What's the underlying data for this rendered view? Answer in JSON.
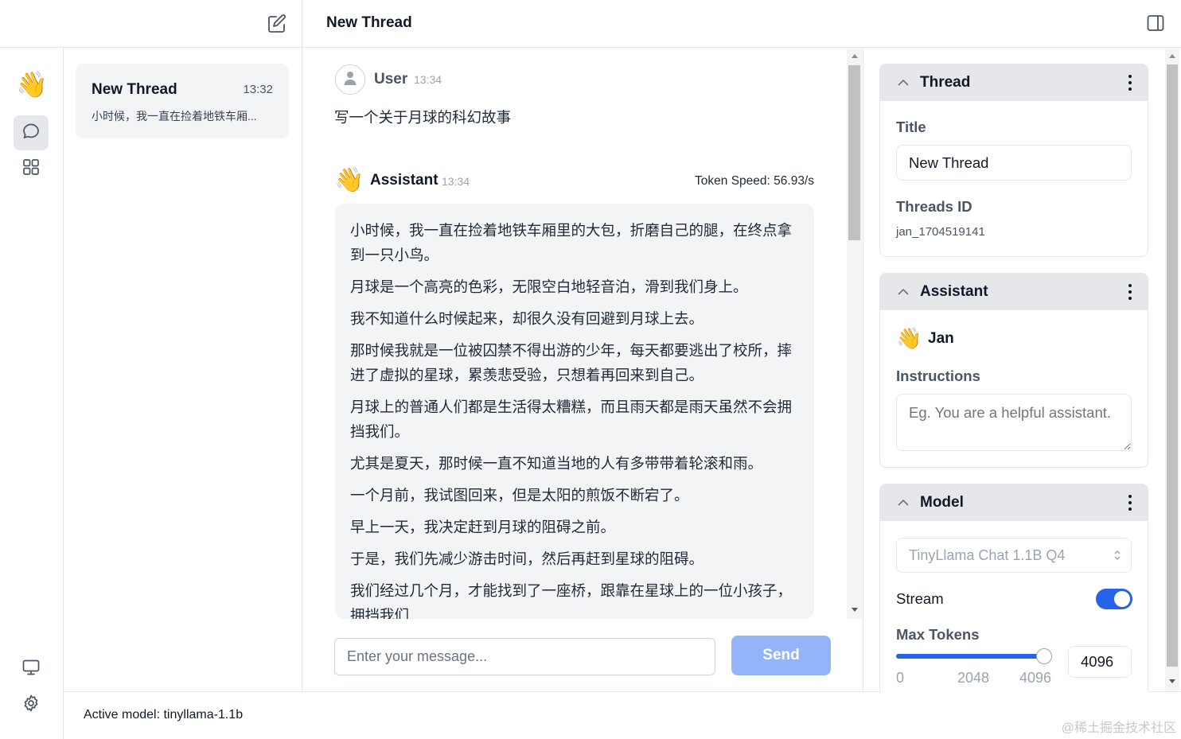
{
  "header": {
    "title": "New Thread"
  },
  "thread_list": {
    "items": [
      {
        "title": "New Thread",
        "time": "13:32",
        "preview": "小时候，我一直在捡着地铁车厢..."
      }
    ]
  },
  "chat": {
    "user_message": {
      "name": "User",
      "time": "13:34",
      "text": "写一个关于月球的科幻故事"
    },
    "assistant_message": {
      "name": "Assistant",
      "time": "13:34",
      "token_speed": "Token Speed: 56.93/s",
      "paragraphs": [
        "小时候，我一直在捡着地铁车厢里的大包，折磨自己的腿，在终点拿到一只小鸟。",
        "月球是一个高亮的色彩，无限空白地轻音泊，滑到我们身上。",
        "我不知道什么时候起来，却很久没有回避到月球上去。",
        "那时候我就是一位被囚禁不得出游的少年，每天都要逃出了校所，摔进了虚拟的星球，累羡悲受验，只想着再回来到自己。",
        "月球上的普通人们都是生活得太糟糕，而且雨天都是雨天虽然不会拥挡我们。",
        "尤其是夏天，那时候一直不知道当地的人有多带带着轮滚和雨。",
        "一个月前，我试图回来，但是太阳的煎饭不断宕了。",
        "早上一天，我决定赶到月球的阻碍之前。",
        "于是，我们先减少游击时间，然后再赶到星球的阻碍。",
        "我们经过几个月，才能找到了一座桥，跟靠在星球上的一位小孩子，拥挡我们"
      ]
    },
    "input": {
      "placeholder": "Enter your message...",
      "value": ""
    },
    "send_label": "Send"
  },
  "right_panel": {
    "thread": {
      "header": "Thread",
      "title_label": "Title",
      "title_value": "New Thread",
      "id_label": "Threads ID",
      "id_value": "jan_1704519141"
    },
    "assistant": {
      "header": "Assistant",
      "name": "Jan",
      "instructions_label": "Instructions",
      "instructions_placeholder": "Eg. You are a helpful assistant."
    },
    "model": {
      "header": "Model",
      "selected_model": "TinyLlama Chat 1.1B Q4",
      "stream_label": "Stream",
      "stream_on": true,
      "max_tokens_label": "Max Tokens",
      "max_tokens_value": "4096",
      "slider_fraction": 1.0,
      "slider_ticks": [
        "0",
        "2048",
        "4096"
      ]
    }
  },
  "status_bar": {
    "active_model": "Active model: tinyllama-1.1b"
  },
  "watermark": "@稀土掘金技术社区",
  "colors": {
    "accent": "#2563eb",
    "send_disabled": "#93b4f8",
    "panel_header": "#e5e7eb",
    "bubble": "#f3f4f6"
  },
  "icons": {
    "new_thread": "edit-icon",
    "toggle_panel": "panel-right-icon",
    "logo": "waving-hand-icon",
    "chat": "chat-bubble-icon",
    "hub": "grid-icon",
    "system_monitor": "monitor-icon",
    "settings": "gear-icon"
  }
}
